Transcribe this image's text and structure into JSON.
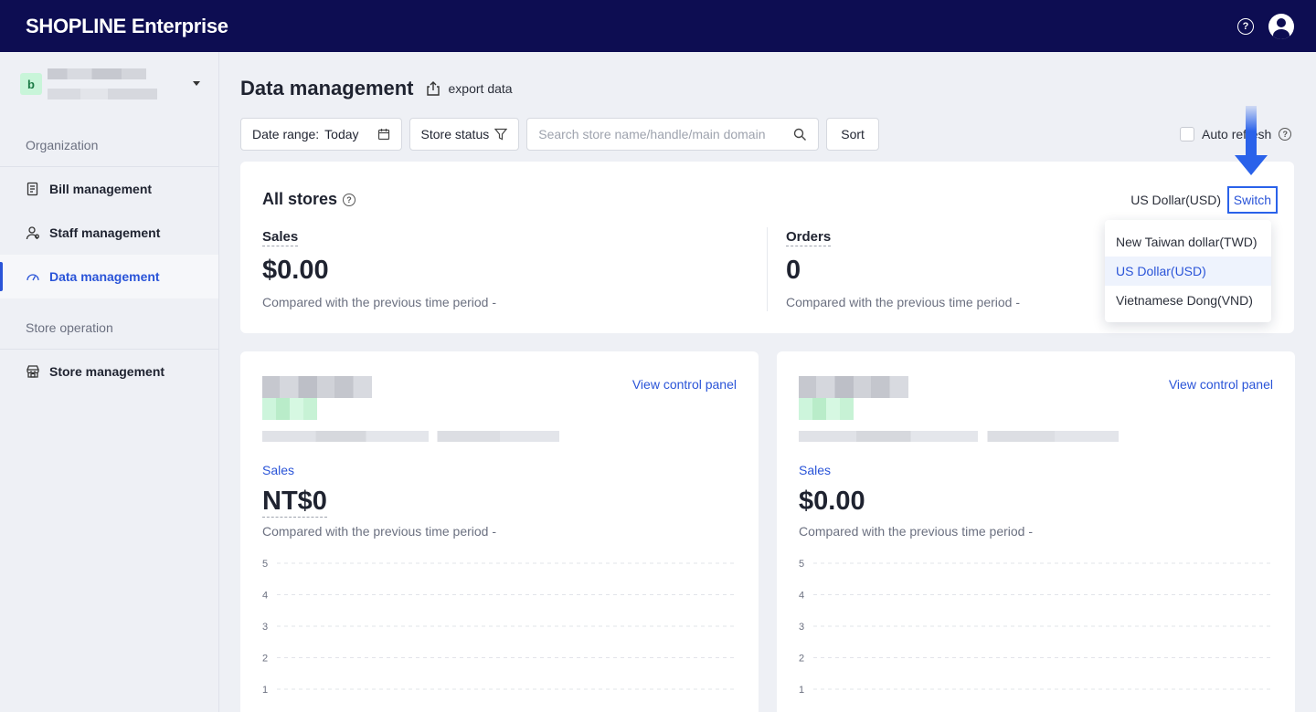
{
  "topbar": {
    "logo": "SHOPLINE Enterprise"
  },
  "sidebar": {
    "org_initial": "b",
    "sections": [
      {
        "title": "Organization",
        "items": [
          {
            "label": "Bill management",
            "icon": "bill-icon"
          },
          {
            "label": "Staff management",
            "icon": "staff-icon"
          },
          {
            "label": "Data management",
            "icon": "dashboard-gauge-icon",
            "active": true
          }
        ]
      },
      {
        "title": "Store operation",
        "items": [
          {
            "label": "Store management",
            "icon": "store-icon"
          }
        ]
      }
    ]
  },
  "main": {
    "title": "Data management",
    "export_label": "export data",
    "filters": {
      "date_range_label": "Date range:",
      "date_range_value": "Today",
      "store_status_label": "Store status",
      "search_placeholder": "Search store name/handle/main domain",
      "sort_label": "Sort"
    },
    "auto_refresh_label": "Auto refresh"
  },
  "all_stores": {
    "title": "All stores",
    "currency": "US Dollar(USD)",
    "switch_label": "Switch",
    "sales_label": "Sales",
    "sales_value": "$0.00",
    "sales_compare": "Compared with the previous time period -",
    "orders_label": "Orders",
    "orders_value": "0",
    "orders_compare": "Compared with the previous time period -"
  },
  "currency_dropdown": {
    "options": [
      "New Taiwan dollar(TWD)",
      "US Dollar(USD)",
      "Vietnamese Dong(VND)"
    ],
    "selected": "US Dollar(USD)"
  },
  "store_cards": [
    {
      "view_label": "View control panel",
      "sales_label": "Sales",
      "sales_value": "NT$0",
      "compare": "Compared with the previous time period -"
    },
    {
      "view_label": "View control panel",
      "sales_label": "Sales",
      "sales_value": "$0.00",
      "compare": "Compared with the previous time period -"
    }
  ],
  "chart_data": [
    {
      "type": "line",
      "y_ticks": [
        "5",
        "4",
        "3",
        "2",
        "1"
      ],
      "ylim": [
        0,
        5
      ],
      "series": []
    },
    {
      "type": "line",
      "y_ticks": [
        "5",
        "4",
        "3",
        "2",
        "1"
      ],
      "ylim": [
        0,
        5
      ],
      "series": []
    }
  ],
  "colors": {
    "topbar": "#0d0d52",
    "accent": "#2a54d8",
    "annotation": "#2a62ea"
  }
}
